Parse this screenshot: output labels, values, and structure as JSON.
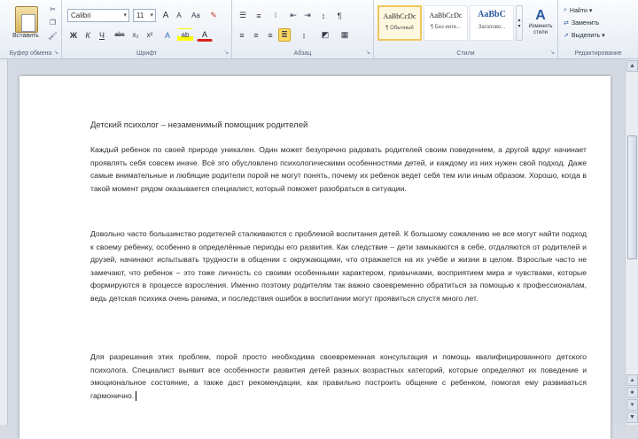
{
  "ribbon": {
    "clipboard": {
      "label": "Буфер обмена",
      "paste": "Вставить"
    },
    "font": {
      "label": "Шрифт",
      "font_name": "Calibri",
      "font_size": "11",
      "grow": "A",
      "shrink": "A",
      "bold": "Ж",
      "italic": "К",
      "underline": "Ч",
      "strike": "abc",
      "subscript": "x₂",
      "superscript": "x²",
      "case": "Aa",
      "highlight": "ab",
      "color": "A"
    },
    "paragraph": {
      "label": "Абзац"
    },
    "styles": {
      "label": "Стили",
      "items": [
        {
          "sample": "AaBbCcDc",
          "name": "¶ Обычный"
        },
        {
          "sample": "AaBbCcDc",
          "name": "¶ Без инте..."
        },
        {
          "sample": "AaBbC",
          "name": "Заголово..."
        }
      ],
      "change_styles": "Изменить стили"
    },
    "editing": {
      "label": "Редактирование",
      "find": "Найти ▾",
      "replace": "Заменить",
      "select": "Выделить ▾"
    }
  },
  "document": {
    "title": "Детский психолог – незаменимый помощник родителей",
    "paragraphs": [
      "Каждый ребенок по своей природе уникален. Один может безупречно радовать родителей своим поведением, а другой вдруг начинает проявлять себя совсем иначе. Всё это обусловлено психологическими особенностями детей, и каждому из них нужен свой подход. Даже самые внимательные и любящие родители порой не могут понять, почему их ребенок ведет себя тем или иным образом. Хорошо, когда в такой момент рядом оказывается специалист, который поможет разобраться в ситуации.",
      "Довольно часто большинство родителей сталкиваются с проблемой воспитания детей. К большому сожалению не все могут найти подход к своему ребенку, особенно в определённые периоды его развития. Как следствие – дети замыкаются в себе, отдаляются от родителей и друзей, начинают испытывать трудности в общении с окружающими, что отражается на их учёбе и жизни в целом. Взрослые часто не замечают, что ребенок – это тоже личность со своими особенными характером, привычками, восприятием мира и чувствами, которые формируются в процессе взросления. Именно поэтому родителям так важно своевременно обратиться за помощью к профессионалам, ведь детская психика очень ранима, и последствия ошибок в воспитании могут проявиться спустя много лет.",
      "Для разрешения этих проблем, порой просто необходима своевременная консультация и помощь квалифицированного детского психолога. Специалист выявит все особенности развития детей разных возрастных категорий, которые определяют их поведение и эмоциональное состояние, а также даст рекомендации, как правильно построить общение с ребенком, помогая ему развиваться гармонично."
    ]
  },
  "colors": {
    "ribbon_bg": "#e6ebf3",
    "canvas_bg": "#d5d9e2",
    "page_bg": "#ffffff",
    "selected_style": "#f2c65a"
  }
}
